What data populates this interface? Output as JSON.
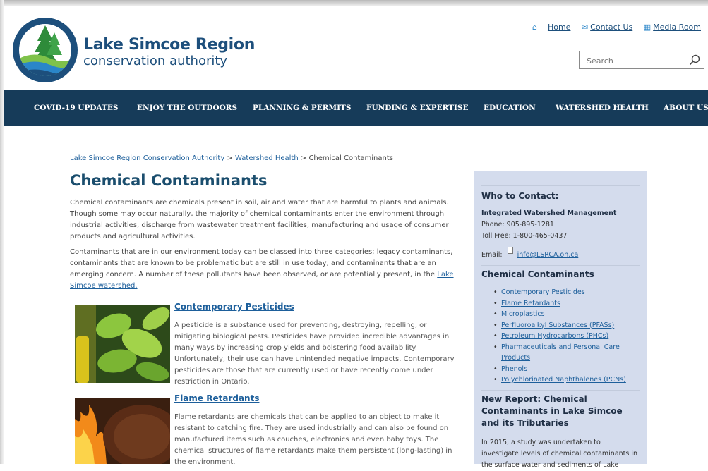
{
  "header": {
    "org_title": "Lake Simcoe Region",
    "org_subtitle": "conservation authority",
    "links": {
      "home": "Home",
      "contact": "Contact Us",
      "media": "Media Room"
    },
    "search_placeholder": "Search"
  },
  "nav": {
    "items": [
      "COVID-19 UPDATES",
      "ENJOY THE OUTDOORS",
      "PLANNING & PERMITS",
      "FUNDING & EXPERTISE",
      "EDUCATION",
      "WATERSHED HEALTH",
      "ABOUT US"
    ]
  },
  "breadcrumb": {
    "root": "Lake Simcoe Region Conservation Authority",
    "sep1": ">",
    "parent": "Watershed Health",
    "sep2": ">",
    "current": "Chemical Contaminants"
  },
  "main": {
    "title": "Chemical Contaminants",
    "intro1": "Chemical contaminants are chemicals present in soil, air and water that are harmful to plants and animals. Though some may occur naturally, the majority of chemical contaminants enter the environment through industrial activities, discharge from wastewater treatment facilities, manufacturing and usage of consumer products and agricultural activities.",
    "intro2": "Contaminants that are in our environment today can be classed into three categories; legacy contaminants, contaminants that are known to be problematic but are still in use today, and contaminants that are an emerging concern. A number of these pollutants have been observed, or are potentially present, in the",
    "intro2_link": "Lake Simcoe watershed.",
    "items": [
      {
        "title": "Contemporary Pesticides",
        "desc": "A pesticide is a substance used for preventing, destroying, repelling, or mitigating biological pests. Pesticides have provided incredible advantages in many ways by increasing crop yields and bolstering food availability. Unfortunately, their use can have unintended negative impacts. Contemporary pesticides are those that are currently used or have recently come under restriction in Ontario."
      },
      {
        "title": "Flame Retardants",
        "desc": "Flame retardants are chemicals that can be applied to an object to make it resistant to catching fire. They are used industrially and can also be found on manufactured items such as couches, electronics and even baby toys. The chemical structures of flame retardants make them persistent (long-lasting) in the environment."
      }
    ]
  },
  "sidebar": {
    "contact_heading": "Who to Contact:",
    "dept": "Integrated Watershed Management",
    "phone": "Phone: 905-895-1281",
    "tollfree": "Toll Free: 1-800-465-0437",
    "email_label": "Email:",
    "email": "info@LSRCA.on.ca",
    "list_heading": "Chemical Contaminants",
    "list": [
      "Contemporary Pesticides",
      "Flame Retardants",
      "Microplastics",
      "Perfluoroalkyl Substances (PFASs)",
      "Petroleum Hydrocarbons (PHCs)",
      "Pharmaceuticals and Personal Care Products",
      "Phenols",
      "Polychlorinated Naphthalenes (PCNs)"
    ],
    "report_heading": "New Report: Chemical Contaminants in Lake Simcoe and its Tributaries",
    "report_text": "In 2015, a study was undertaken to investigate levels of chemical contaminants in the surface water and sediments of Lake"
  }
}
